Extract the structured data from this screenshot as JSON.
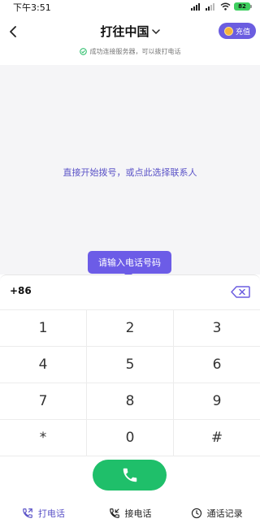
{
  "status_bar": {
    "time": "下午3:51",
    "battery": "82"
  },
  "header": {
    "title": "打往中国",
    "recharge_label": "充值",
    "connection_status": "成功连接服务器，可以拨打电话"
  },
  "main": {
    "hint": "直接开始拨号，或点此选择联系人"
  },
  "tooltip": {
    "text": "请输入电话号码"
  },
  "dial": {
    "country_code": "+86",
    "number_value": "",
    "number_placeholder": ""
  },
  "keypad": {
    "keys": [
      "1",
      "2",
      "3",
      "4",
      "5",
      "6",
      "7",
      "8",
      "9",
      "*",
      "0",
      "#"
    ]
  },
  "bottom_nav": {
    "items": [
      {
        "label": "打电话",
        "active": true
      },
      {
        "label": "接电话",
        "active": false
      },
      {
        "label": "通话记录",
        "active": false
      }
    ]
  },
  "colors": {
    "accent": "#6b5de0",
    "link": "#5a52c7",
    "call_green": "#1fbf6a",
    "battery_green": "#3fcf5f"
  },
  "icons": [
    "back-icon",
    "chevron-down-icon",
    "coin-icon",
    "check-circle-icon",
    "delete-icon",
    "phone-icon",
    "phone-outgoing-icon",
    "phone-incoming-icon",
    "clock-icon",
    "signal-icon",
    "wifi-icon"
  ]
}
